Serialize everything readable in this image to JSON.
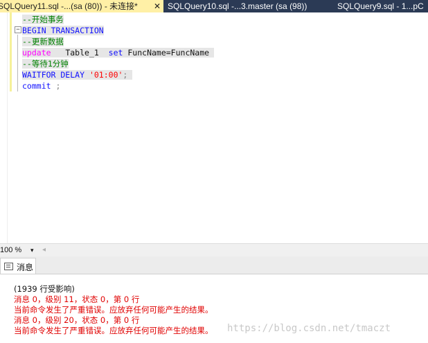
{
  "tabs": [
    {
      "label": "SQLQuery11.sql -...(sa (80)) - 未连接*",
      "close": "✕"
    },
    {
      "label": "SQLQuery10.sql -...3.master (sa (98))"
    },
    {
      "label": "SQLQuery9.sql - 1...pC"
    }
  ],
  "editor": {
    "fold_symbol": "−",
    "lines": {
      "c1": "--开始事务",
      "l2": "BEGIN TRANSACTION",
      "c3": "--更新数据",
      "l4_kw": "update",
      "l4_t": "Table_1",
      "l4_set": "set",
      "l4_assign": "FuncName=FuncName",
      "c5": "--等待1分钟",
      "l6_kw": "WAITFOR DELAY",
      "l6_str": "'01:00'",
      "l6_end": ";",
      "l7": "commit",
      "l7_end": ";"
    }
  },
  "statusbar": {
    "zoom": "100 %",
    "zoom_arrow": "▾",
    "scroll": "◂"
  },
  "results": {
    "tab_label": "消息",
    "messages": [
      {
        "text": "(1939 行受影响)",
        "color": "#111111"
      },
      {
        "text": "消息 0，级别 11，状态 0，第 0 行",
        "color": "#e00000"
      },
      {
        "text": "当前命令发生了严重错误。应放弃任何可能产生的结果。",
        "color": "#e00000"
      },
      {
        "text": "消息 0，级别 20，状态 0，第 0 行",
        "color": "#e00000"
      },
      {
        "text": "当前命令发生了严重错误。应放弃任何可能产生的结果。",
        "color": "#e00000"
      }
    ],
    "watermark": "https://blog.csdn.net/tmaczt"
  }
}
